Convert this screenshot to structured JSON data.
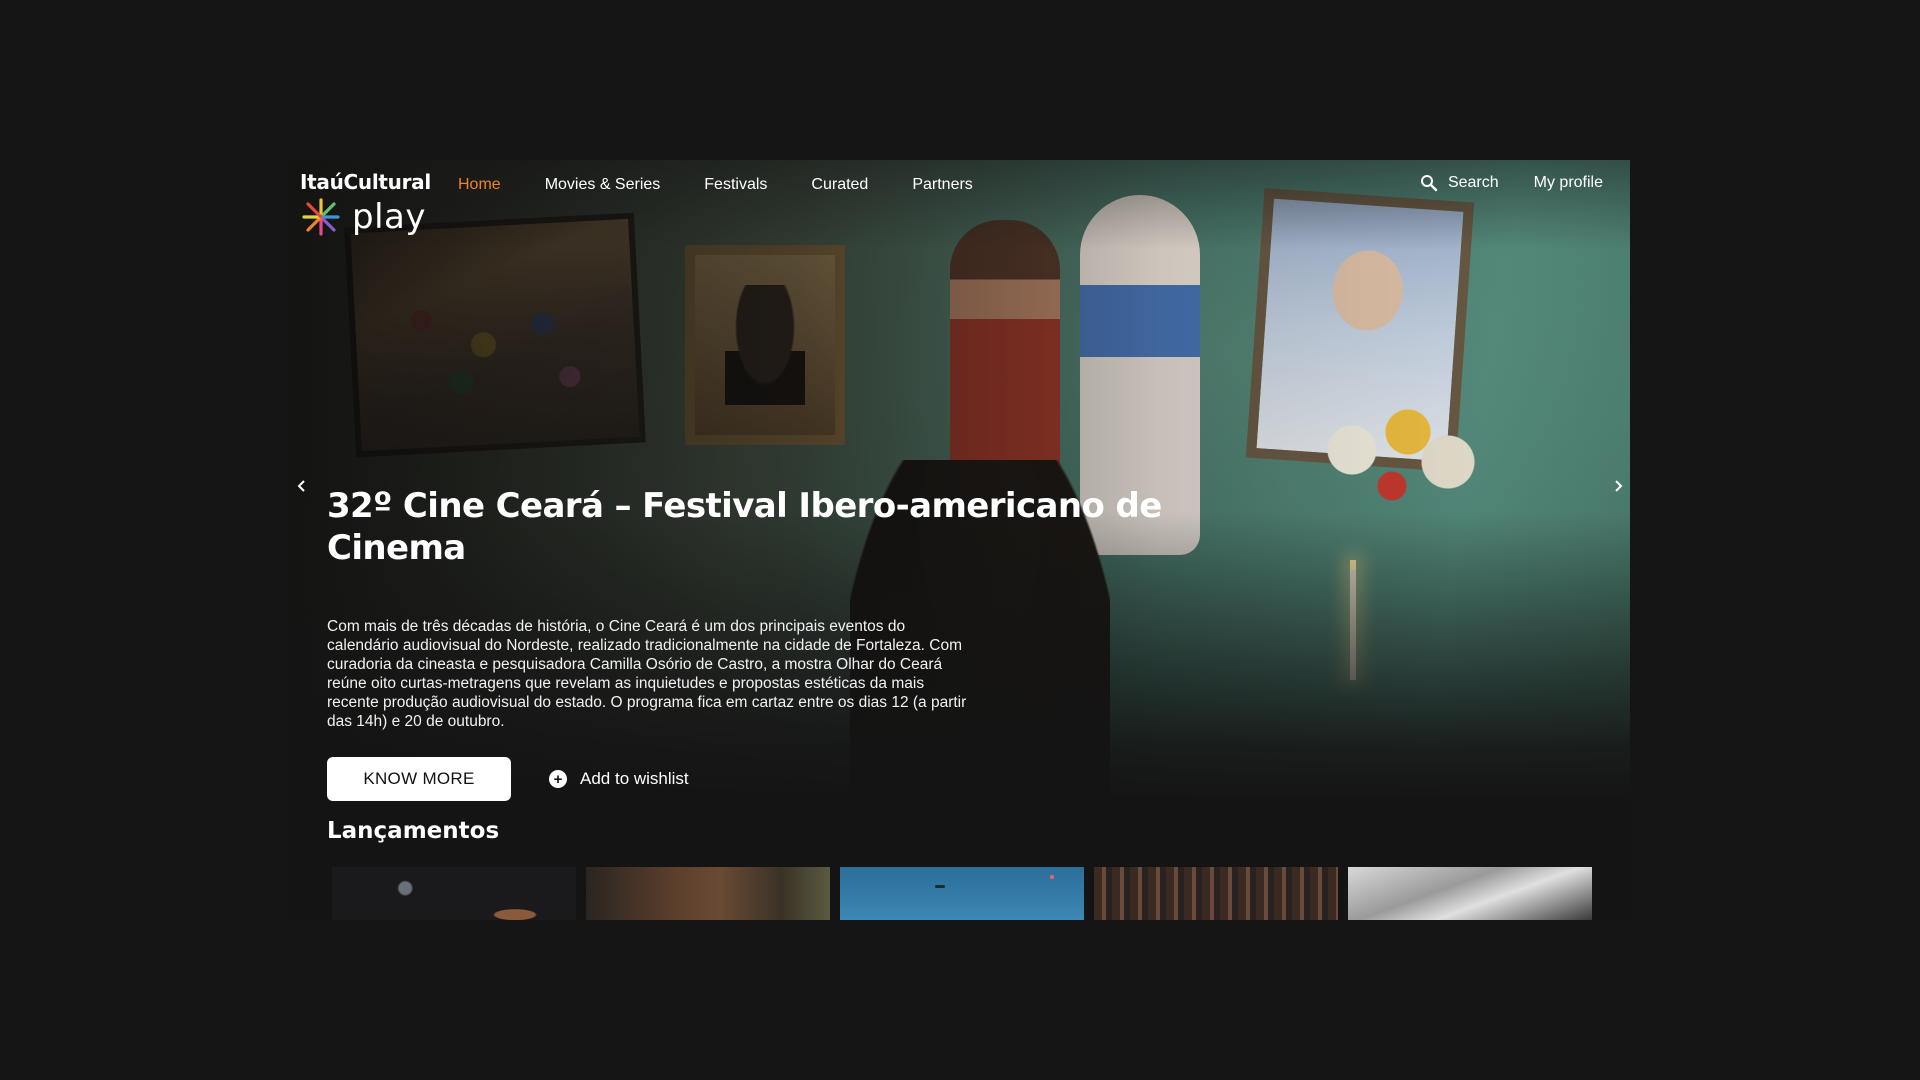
{
  "brand": {
    "name_top": "ItaúCultural",
    "name_bottom": "play",
    "accent_color": "#f0822a"
  },
  "nav": {
    "items": [
      {
        "label": "Home",
        "active": true
      },
      {
        "label": "Movies & Series",
        "active": false
      },
      {
        "label": "Festivals",
        "active": false
      },
      {
        "label": "Curated",
        "active": false
      },
      {
        "label": "Partners",
        "active": false
      }
    ],
    "search_label": "Search",
    "profile_label": "My profile"
  },
  "hero": {
    "title": "32º Cine Ceará – Festival Ibero-americano de Cinema",
    "description": "Com mais de três décadas de história, o Cine Ceará é um dos principais eventos do calendário audiovisual do Nordeste, realizado tradicionalmente na cidade de Fortaleza. Com curadoria da cineasta e pesquisadora Camilla Osório de Castro, a mostra Olhar do Ceará reúne oito curtas-metragens que revelam as inquietudes e propostas estéticas da mais recente produção audiovisual do estado. O programa fica em cartaz entre os dias 12 (a partir das 14h) e 20 de outubro.",
    "primary_button": "KNOW MORE",
    "secondary_button": "Add to wishlist"
  },
  "icons": {
    "search": "search-icon",
    "add": "plus-circle-icon",
    "prev": "chevron-left-icon",
    "next": "chevron-right-icon",
    "logo": "asterisk-star-icon"
  },
  "releases": {
    "title": "Lançamentos",
    "count": 5
  }
}
